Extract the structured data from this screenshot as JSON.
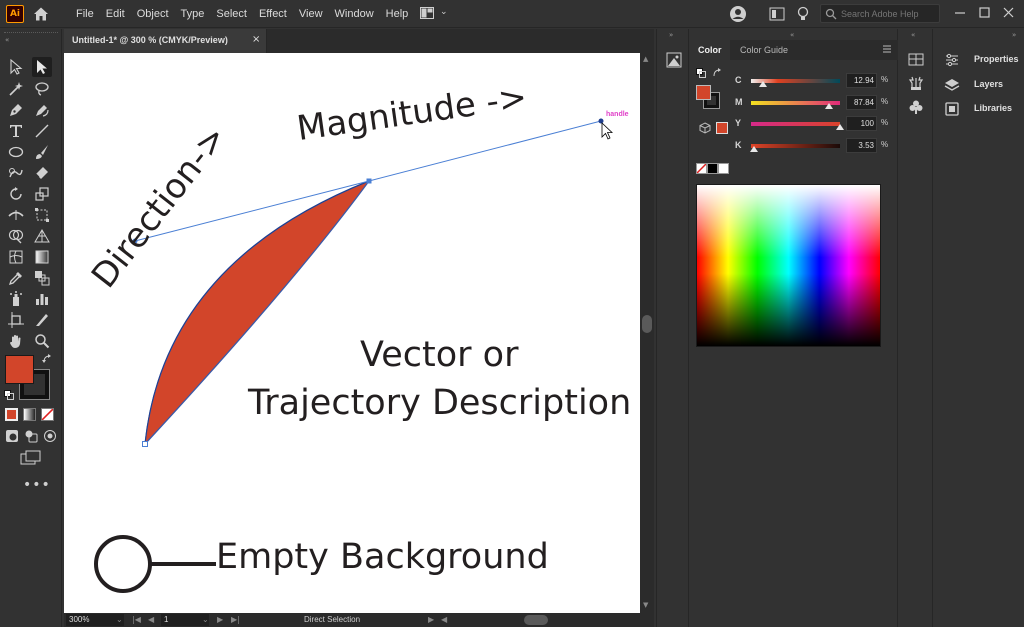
{
  "app": {
    "logo_text": "Ai",
    "menu": [
      "File",
      "Edit",
      "Object",
      "Type",
      "Select",
      "Effect",
      "View",
      "Window",
      "Help"
    ],
    "search_placeholder": "Search Adobe Help"
  },
  "document": {
    "tab_title": "Untitled-1* @ 300 % (CMYK/Preview)",
    "close_glyph": "×"
  },
  "canvas": {
    "magnitude_label": "Magnitude ->",
    "direction_label": "Direction->",
    "vector_line1": "Vector or",
    "vector_line2": "Trajectory Description",
    "empty_background_label": "Empty Background",
    "handle_label": "handle",
    "fill_color": "#d2452a",
    "path_color": "#4a7fd4"
  },
  "status": {
    "zoom": "300%",
    "page": "1",
    "current_tool": "Direct Selection"
  },
  "color_panel": {
    "tab_color": "Color",
    "tab_color_guide": "Color Guide",
    "fill_color": "#d2452a",
    "sliders": [
      {
        "letter": "C",
        "value": "12.94",
        "pct": "%",
        "gradient": "linear-gradient(to right, #f0f0f0, #e04020 30%, #004a5a)",
        "position": 0.1294
      },
      {
        "letter": "M",
        "value": "87.84",
        "pct": "%",
        "gradient": "linear-gradient(to right, #f2e020, #e02a7a)",
        "position": 0.8784
      },
      {
        "letter": "Y",
        "value": "100",
        "pct": "%",
        "gradient": "linear-gradient(to right, #d62a8a, #d8432a)",
        "position": 1.0
      },
      {
        "letter": "K",
        "value": "3.53",
        "pct": "%",
        "gradient": "linear-gradient(to right, #e04428, #1a0a08)",
        "position": 0.0353
      }
    ]
  },
  "right_panel": {
    "items": [
      "Properties",
      "Layers",
      "Libraries"
    ]
  }
}
